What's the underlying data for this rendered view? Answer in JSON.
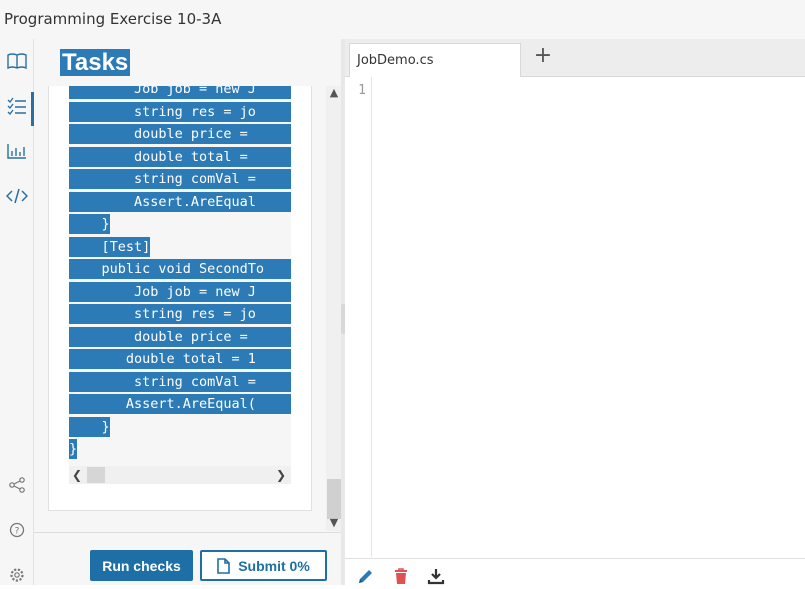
{
  "window": {
    "title": "Programming Exercise 10-3A"
  },
  "rail": {
    "icons": [
      "book-icon",
      "tasks-list-icon",
      "chart-icon",
      "code-icon",
      "share-icon",
      "help-icon",
      "settings-icon"
    ]
  },
  "tasks": {
    "title": "Tasks",
    "code_lines": [
      "        Job job = new J",
      "        string res = jo",
      "        double price = ",
      "        double total = ",
      "        string comVal =",
      "        Assert.AreEqual",
      "    }",
      "    [Test]",
      "    public void SecondTo",
      "        Job job = new J",
      "        string res = jo",
      "        double price = ",
      "       double total = 1",
      "        string comVal =",
      "       Assert.AreEqual(",
      "    }",
      "}"
    ]
  },
  "buttons": {
    "run_checks": "Run checks",
    "submit": "Submit 0%"
  },
  "editor": {
    "tab_label": "JobDemo.cs",
    "add_tab": "+",
    "line_number": "1"
  },
  "colors": {
    "accent": "#1e6fa5",
    "selection": "#2c7bb6",
    "delete": "#e05252"
  }
}
